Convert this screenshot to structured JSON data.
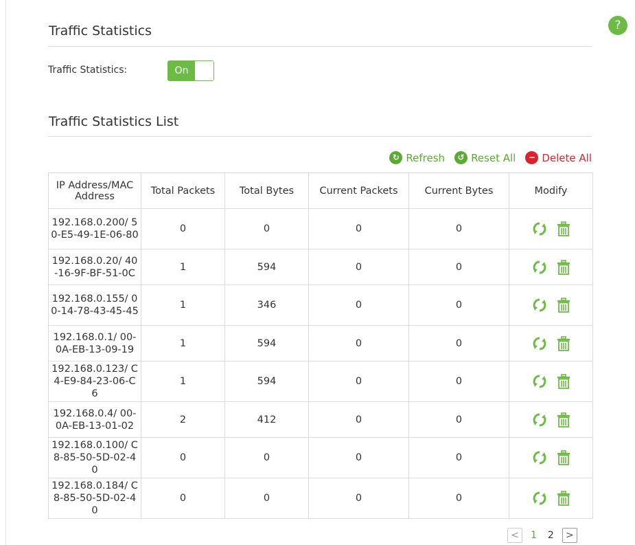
{
  "help": {
    "glyph": "?"
  },
  "section1": {
    "title": "Traffic Statistics",
    "field_label": "Traffic Statistics:",
    "toggle_label": "On"
  },
  "section2": {
    "title": "Traffic Statistics List"
  },
  "actions": {
    "refresh": "Refresh",
    "reset_all": "Reset All",
    "delete_all": "Delete All"
  },
  "table": {
    "headers": [
      "IP Address/MAC Address",
      "Total Packets",
      "Total Bytes",
      "Current Packets",
      "Current Bytes",
      "Modify"
    ],
    "rows": [
      [
        "192.168.0.200/ 50-E5-49-1E-06-80",
        "0",
        "0",
        "0",
        "0"
      ],
      [
        "192.168.0.20/ 40-16-9F-BF-51-0C",
        "1",
        "594",
        "0",
        "0"
      ],
      [
        "192.168.0.155/ 00-14-78-43-45-45",
        "1",
        "346",
        "0",
        "0"
      ],
      [
        "192.168.0.1/ 00-0A-EB-13-09-19",
        "1",
        "594",
        "0",
        "0"
      ],
      [
        "192.168.0.123/ C4-E9-84-23-06-C6",
        "1",
        "594",
        "0",
        "0"
      ],
      [
        "192.168.0.4/ 00-0A-EB-13-01-02",
        "2",
        "412",
        "0",
        "0"
      ],
      [
        "192.168.0.100/ C8-85-50-5D-02-40",
        "0",
        "0",
        "0",
        "0"
      ],
      [
        "192.168.0.184/ C8-85-50-5D-02-40",
        "0",
        "0",
        "0",
        "0"
      ]
    ]
  },
  "pagination": {
    "pages": [
      "1",
      "2"
    ],
    "current": "1",
    "prev_glyph": "<",
    "next_glyph": ">"
  },
  "colors": {
    "accent": "#6dbb45",
    "danger": "#d9232d"
  },
  "icons": {
    "refresh_row": "refresh-icon",
    "delete_row": "trash-icon"
  }
}
